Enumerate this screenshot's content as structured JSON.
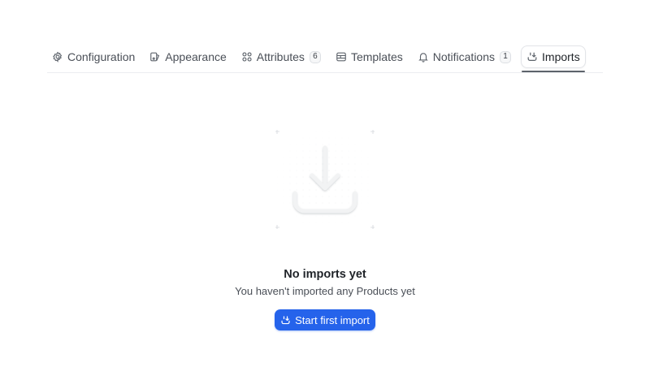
{
  "tabs": [
    {
      "label": "Configuration",
      "icon": "gear-icon"
    },
    {
      "label": "Appearance",
      "icon": "palette-icon"
    },
    {
      "label": "Attributes",
      "icon": "grid-icon",
      "badge": "6"
    },
    {
      "label": "Templates",
      "icon": "layers-icon"
    },
    {
      "label": "Notifications",
      "icon": "bell-icon",
      "badge": "1"
    },
    {
      "label": "Imports",
      "icon": "import-icon",
      "active": true
    }
  ],
  "empty_state": {
    "title": "No imports yet",
    "subtitle": "You haven't imported any Products yet",
    "illustration_icon": "download-icon",
    "button_label": "Start first import",
    "button_icon": "import-icon"
  },
  "colors": {
    "accent": "#2563eb",
    "text": "#1f2328",
    "muted": "#4a4f57",
    "border": "#ebedf0"
  }
}
